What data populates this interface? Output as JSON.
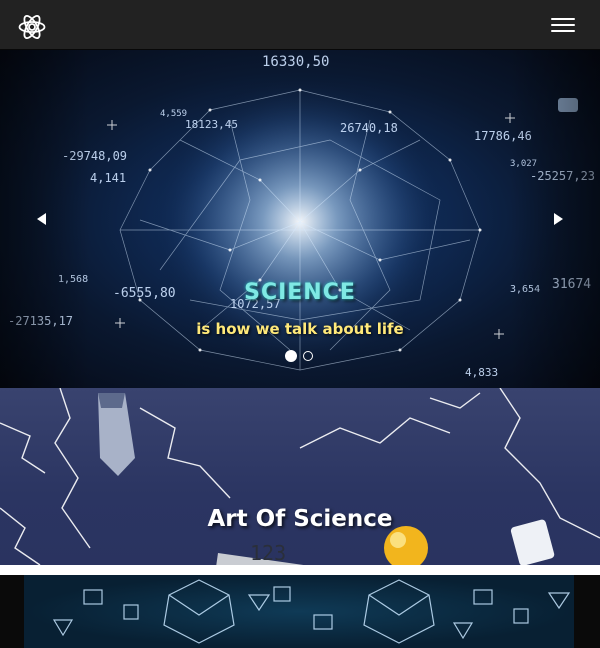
{
  "navbar": {
    "brand_icon": "atom-icon",
    "toggle_icon": "hamburger-icon",
    "background": "#222222"
  },
  "carousel": {
    "slides": [
      {
        "title": "SCIENCE",
        "subtitle": "is how we talk about life"
      },
      {
        "title": "",
        "subtitle": ""
      }
    ],
    "active_index": 0,
    "prev_label": "Previous",
    "next_label": "Next",
    "overlay_numbers": [
      "16330,50",
      "-29748,09",
      "4,141",
      "-6555,80",
      "-27135,17",
      "18123,45",
      "26740,18",
      "17786,46",
      "-25257,23",
      "31674",
      "1072,57",
      "4,833",
      "3,654",
      "1,568",
      "4,559",
      "3,027"
    ],
    "title_color": "#7fe9e4",
    "subtitle_color": "#ffe97a"
  },
  "art": {
    "title": "Art Of Science",
    "gauge_reading": "123"
  },
  "bottom": {
    "pattern_color": "#c8e6ff",
    "background": "#082033"
  }
}
